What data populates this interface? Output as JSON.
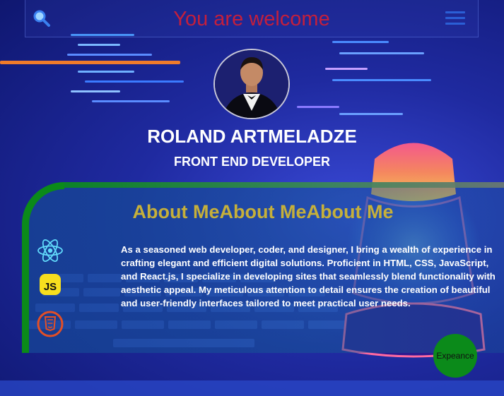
{
  "header": {
    "title": "You are welcome",
    "search_icon": "search-icon",
    "menu_icon": "hamburger-menu-icon"
  },
  "profile": {
    "name": "ROLAND ARTMELADZE",
    "role": "FRONT END DEVELOPER"
  },
  "about": {
    "title": "About MeAbout MeAbout Me",
    "text": "As a seasoned web developer, coder, and designer, I bring a wealth of experience in crafting elegant and efficient digital solutions. Proficient in HTML, CSS, JavaScript, and React.js, I specialize in developing sites that seamlessly blend functionality with aesthetic appeal. My meticulous attention to detail ensures the creation of beautiful and user-friendly interfaces tailored to meet practical user needs.",
    "tech_icons": [
      "react-icon",
      "javascript-icon",
      "html5-icon"
    ]
  },
  "actions": {
    "experience_label": "Expeance"
  },
  "colors": {
    "title_red": "#c41f3c",
    "about_gold": "#c6b03a",
    "accent_green": "#0b8a1a",
    "menu_blue": "#2b5fd6"
  }
}
